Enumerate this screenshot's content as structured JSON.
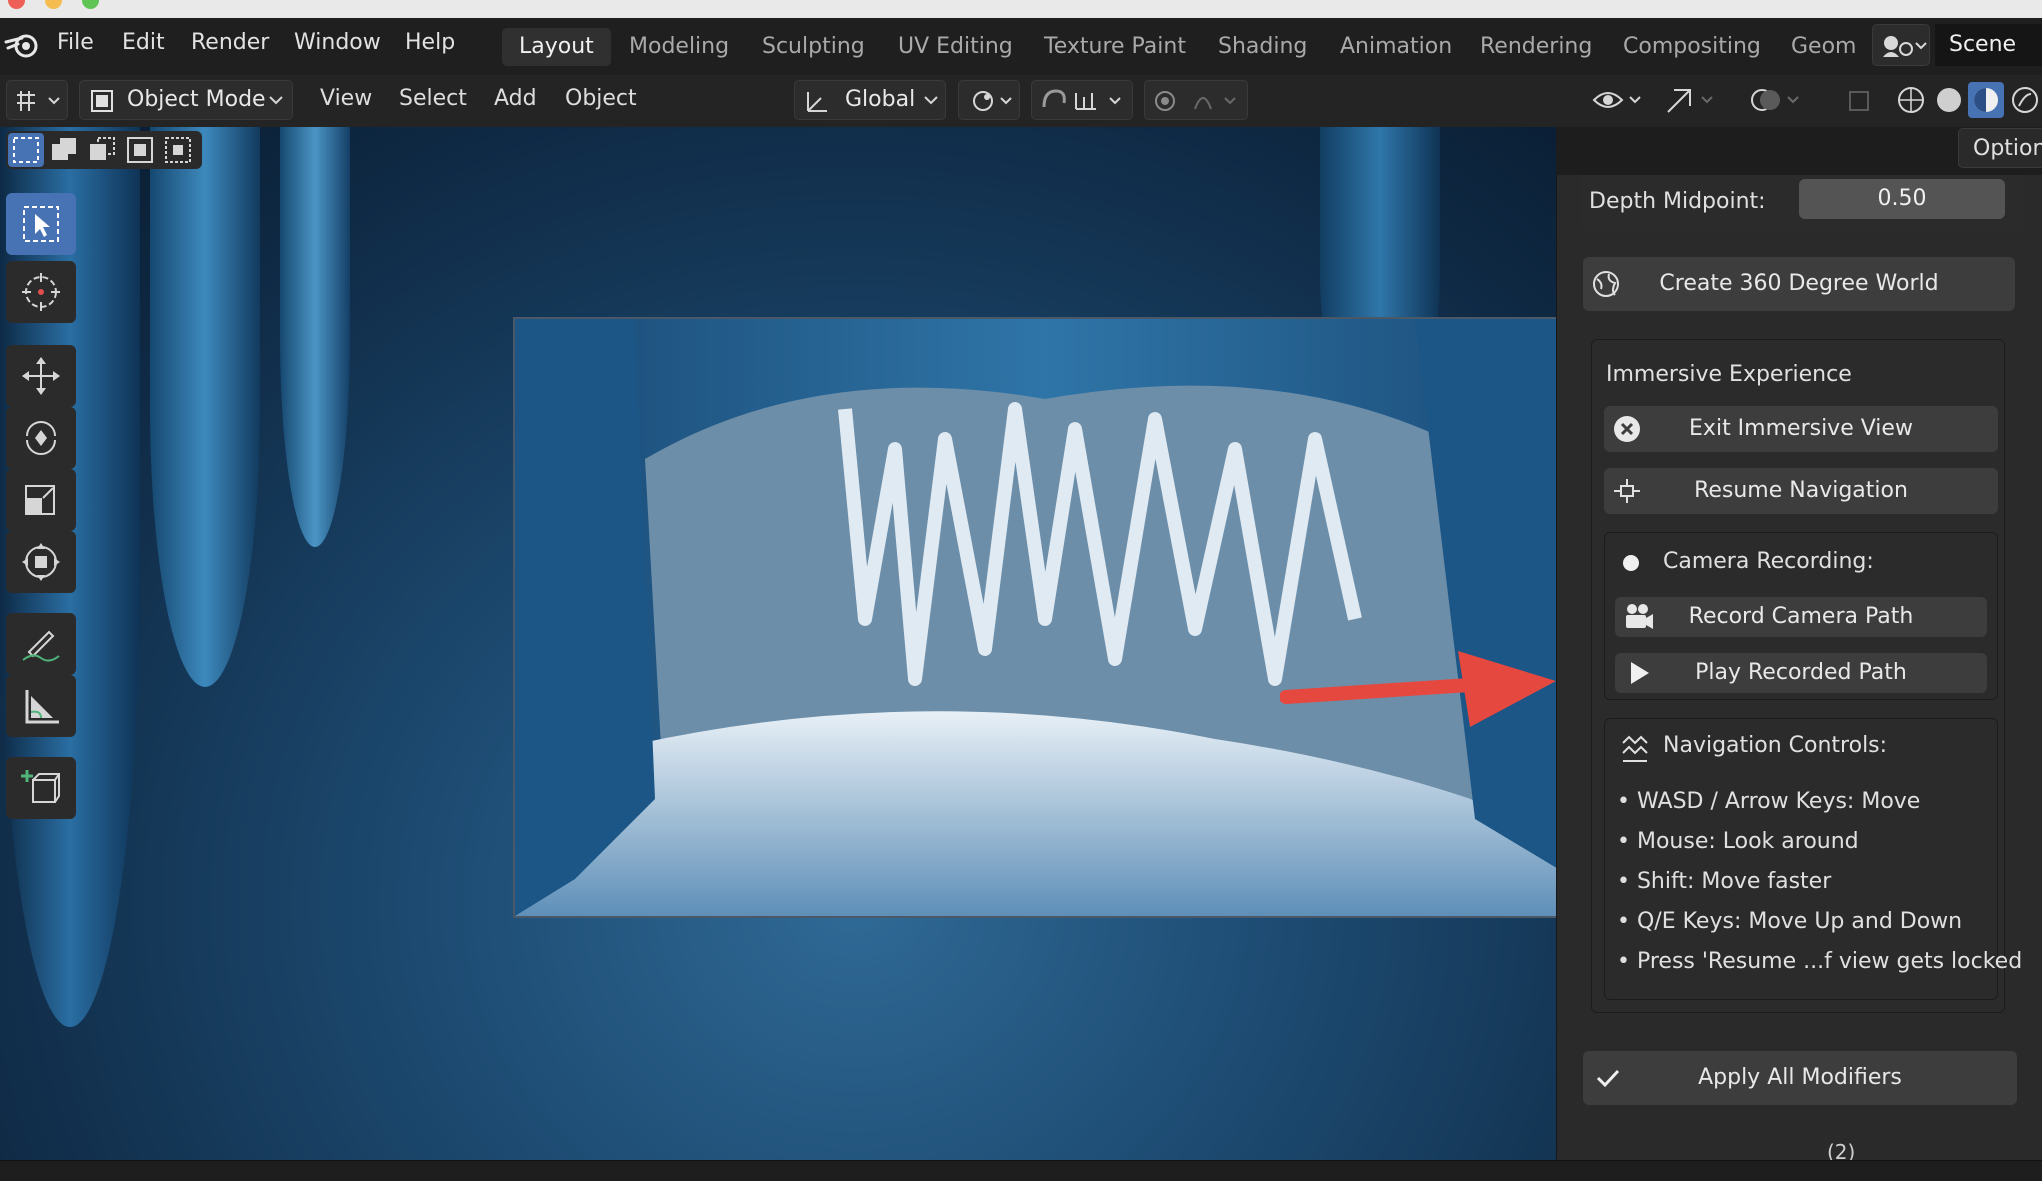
{
  "menu": {
    "file": "File",
    "edit": "Edit",
    "render": "Render",
    "window": "Window",
    "help": "Help"
  },
  "workspaces": [
    "Layout",
    "Modeling",
    "Sculpting",
    "UV Editing",
    "Texture Paint",
    "Shading",
    "Animation",
    "Rendering",
    "Compositing",
    "Geom"
  ],
  "scene_label": "Scene",
  "header": {
    "mode": "Object Mode",
    "view": "View",
    "select": "Select",
    "add": "Add",
    "object": "Object",
    "transform_orientation": "Global",
    "options": "Option"
  },
  "panel": {
    "depth_midpoint_label": "Depth Midpoint:",
    "depth_midpoint_value": "0.50",
    "create_world": "Create 360 Degree World",
    "immersive_title": "Immersive Experience",
    "exit_immersive": "Exit Immersive View",
    "resume_navigation": "Resume Navigation",
    "camera_recording_label": "Camera Recording:",
    "record_camera_path": "Record Camera Path",
    "play_recorded_path": "Play Recorded Path",
    "navigation_controls_label": "Navigation Controls:",
    "nav_lines": [
      "• WASD / Arrow Keys: Move",
      "• Mouse: Look around",
      "• Shift: Move faster",
      "• Q/E Keys: Move Up and Down",
      "• Press 'Resume ...f view gets locked"
    ],
    "apply_modifiers": "Apply All Modifiers",
    "partial_bottom": "(2)"
  },
  "colors": {
    "accent_blue": "#4772b3",
    "annotation_arrow": "#e5483f",
    "panel_bg": "#2a2a2a",
    "button_bg": "#3d3d3d"
  }
}
